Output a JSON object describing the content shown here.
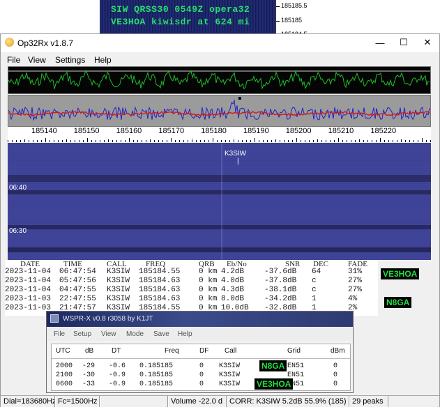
{
  "top_overlay": {
    "line1": "SIW QRSS30 0549Z opera32",
    "line2": "VE3HOA kiwisdr at 624 mi",
    "scale_labels": [
      "185185.5",
      "185185",
      "185184.5",
      "185184"
    ]
  },
  "window": {
    "title": "Op32Rx v1.8.7",
    "minimize": "—",
    "maximize": "☐",
    "close": "✕"
  },
  "menu": {
    "file": "File",
    "view": "View",
    "settings": "Settings",
    "help": "Help"
  },
  "freq_scale": [
    "185140",
    "185150",
    "185160",
    "185170",
    "185180",
    "185190",
    "185200",
    "185210",
    "185220"
  ],
  "waterfall": {
    "times": [
      "06:40",
      "06:30"
    ],
    "spot_label": "K3SIW",
    "spot_marker": "|"
  },
  "spots": {
    "headers": [
      "DATE",
      "TIME",
      "CALL",
      "FREQ",
      "QRB",
      "Eb/No",
      "SNR",
      "DEC",
      "FADE"
    ],
    "rows": [
      [
        "2023-11-04",
        "06:47:54",
        "K3SIW",
        "185184.55",
        "0 km",
        "4.2dB",
        "-37.6dB",
        "64",
        "31%"
      ],
      [
        "2023-11-04",
        "05:47:56",
        "K3SIW",
        "185184.63",
        "0 km",
        "4.0dB",
        "-37.8dB",
        "c",
        "27%"
      ],
      [
        "2023-11-04",
        "04:47:55",
        "K3SIW",
        "185184.63",
        "0 km",
        "4.3dB",
        "-38.1dB",
        "c",
        "27%"
      ],
      [
        "2023-11-03",
        "22:47:55",
        "K3SIW",
        "185184.63",
        "0 km",
        "8.0dB",
        "-34.2dB",
        "1",
        "4%"
      ],
      [
        "2023-11-03",
        "21:47:57",
        "K3SIW",
        "185184.55",
        "0 km",
        "10.0dB",
        "-32.8dB",
        "1",
        "2%"
      ]
    ]
  },
  "tags": {
    "ve3hoa": "VE3HOA",
    "n8ga": "N8GA"
  },
  "wsprx": {
    "title": "WSPR-X  v0.8  r3058   by K1JT",
    "menu": [
      "File",
      "Setup",
      "View",
      "Mode",
      "Save",
      "Help"
    ],
    "headers": [
      "UTC",
      "dB",
      "DT",
      "Freq",
      "DF",
      "Call",
      "Grid",
      "dBm"
    ],
    "rows": [
      [
        "2000",
        "-29",
        "-0.6",
        "0.185185",
        "0",
        "K3SIW",
        "EN51",
        "0"
      ],
      [
        "2100",
        "-30",
        "-0.9",
        "0.185185",
        "0",
        "K3SIW",
        "EN51",
        "0"
      ],
      [
        "0600",
        "-33",
        "-0.9",
        "0.185185",
        "0",
        "K3SIW",
        "EN51",
        "0"
      ]
    ]
  },
  "status": {
    "dial": "Dial=183680Hz",
    "fc": "Fc=1500Hz",
    "volume": "Volume -22.0 d",
    "corr": "CORR: K3SIW 5.2dB 55.9% (185)",
    "peaks": "29 peaks"
  }
}
